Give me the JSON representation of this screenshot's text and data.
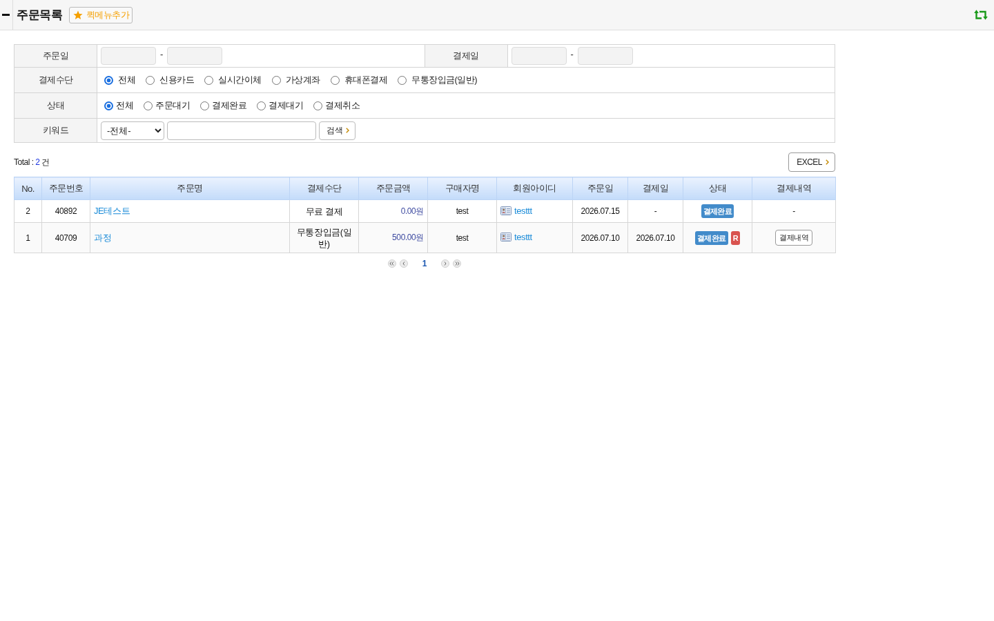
{
  "header": {
    "title": "주문목록",
    "quick_menu_button": "퀵메뉴추가"
  },
  "search_form": {
    "order_date": {
      "label": "주문일",
      "separator": "-"
    },
    "payment_date": {
      "label": "결제일",
      "separator": "-"
    },
    "payment_method": {
      "label": "결제수단",
      "options": [
        {
          "label": "전체",
          "selected": true
        },
        {
          "label": "신용카드",
          "selected": false
        },
        {
          "label": "실시간이체",
          "selected": false
        },
        {
          "label": "가상계좌",
          "selected": false
        },
        {
          "label": "휴대폰결제",
          "selected": false
        },
        {
          "label": "무통장입금(일반)",
          "selected": false
        }
      ]
    },
    "status": {
      "label": "상태",
      "options": [
        {
          "label": "전체",
          "selected": true
        },
        {
          "label": "주문대기",
          "selected": false
        },
        {
          "label": "결제완료",
          "selected": false
        },
        {
          "label": "결제대기",
          "selected": false
        },
        {
          "label": "결제취소",
          "selected": false
        }
      ]
    },
    "keyword": {
      "label": "키워드",
      "select": "-전체-",
      "search_button": "검색"
    }
  },
  "summary": {
    "label": "Total :",
    "count": "2",
    "unit": "건"
  },
  "excel_button": "EXCEL",
  "table": {
    "columns": [
      "No.",
      "주문번호",
      "주문명",
      "결제수단",
      "주문금액",
      "구매자명",
      "회원아이디",
      "주문일",
      "결제일",
      "상태",
      "결제내역"
    ],
    "rows": [
      {
        "no": "2",
        "order_number": "40892",
        "order_name": "JE테스트",
        "payment_method": "무료 결제",
        "amount": "0.00원",
        "buyer": "test",
        "member_id": "testtt",
        "order_date": "2026.07.15",
        "payment_date": "-",
        "status_badges": [
          {
            "label": "결제완료",
            "color": "#428bca"
          }
        ],
        "payment_details": {
          "kind": "text",
          "label": "-"
        }
      },
      {
        "no": "1",
        "order_number": "40709",
        "order_name": "과정",
        "payment_method": "무통장입금(일반)",
        "amount": "500.00원",
        "buyer": "test",
        "member_id": "testtt",
        "order_date": "2026.07.10",
        "payment_date": "2026.07.10",
        "status_badges": [
          {
            "label": "결제완료",
            "color": "#428bca"
          },
          {
            "label": "R",
            "color": "#d9534f"
          }
        ],
        "payment_details": {
          "kind": "button",
          "label": "결제내역"
        }
      }
    ]
  },
  "pagination": {
    "pages": [
      {
        "label": "1",
        "selected": true
      }
    ]
  }
}
